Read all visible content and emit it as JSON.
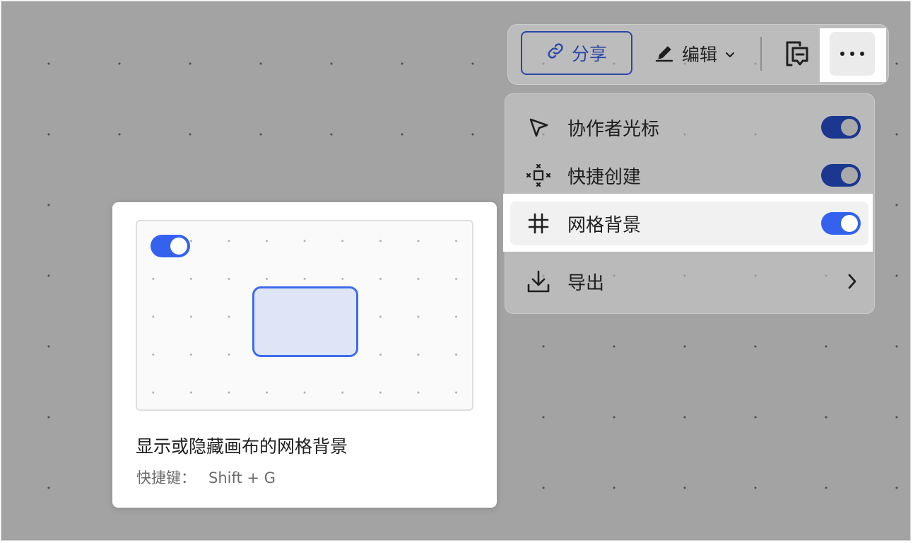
{
  "toolbar": {
    "share_label": "分享",
    "edit_label": "编辑"
  },
  "menu": {
    "items": [
      {
        "label": "协作者光标",
        "icon": "cursor-arrow-icon",
        "toggle": "on"
      },
      {
        "label": "快捷创建",
        "icon": "quick-create-icon",
        "toggle": "on"
      },
      {
        "label": "网格背景",
        "icon": "grid-icon",
        "toggle": "on",
        "highlighted": true
      },
      {
        "label": "导出",
        "icon": "download-icon",
        "chevron": true
      }
    ]
  },
  "tooltip": {
    "title": "显示或隐藏画布的网格背景",
    "shortcut_label": "快捷键：",
    "shortcut_keys": "Shift + G"
  },
  "colors": {
    "accent": "#3462ef",
    "share_border": "#2a47a8",
    "overlay": "rgba(0,0,0,0.34)"
  }
}
